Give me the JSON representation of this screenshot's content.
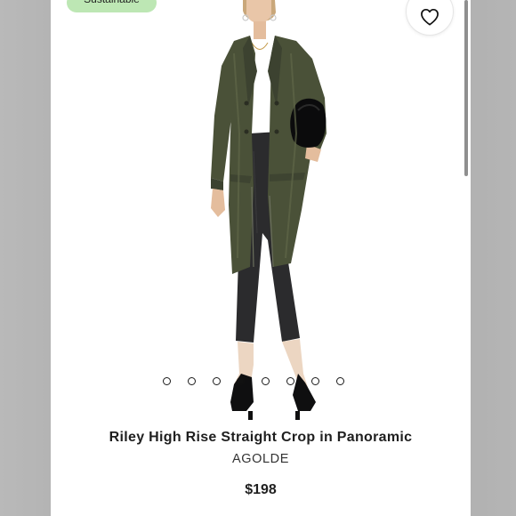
{
  "badge": {
    "label": "Sustainable"
  },
  "wishlist": {
    "icon": "heart-outline-icon"
  },
  "carousel": {
    "total": 8,
    "active_index": 3
  },
  "product": {
    "title": "Riley High Rise Straight Crop in Panoramic",
    "brand": "AGOLDE",
    "price": "$198"
  },
  "colors": {
    "badge_bg": "#bde7b4",
    "coat": "#4a5138",
    "jeans": "#2b2b2d",
    "text": "#1f1f1f"
  }
}
